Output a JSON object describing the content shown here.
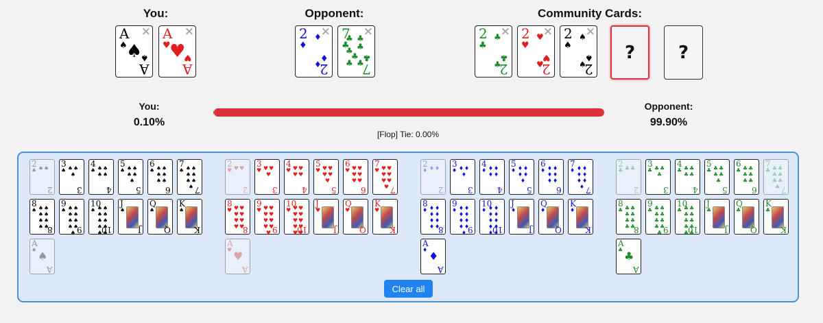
{
  "headings": {
    "you": "You:",
    "opponent": "Opponent:",
    "community": "Community Cards:"
  },
  "you_cards": [
    {
      "rank": "A",
      "suit": "♠",
      "color": "#000000"
    },
    {
      "rank": "A",
      "suit": "♥",
      "color": "#e02020"
    }
  ],
  "opponent_cards": [
    {
      "rank": "2",
      "suit": "♦",
      "color": "#1010dd"
    },
    {
      "rank": "7",
      "suit": "♣",
      "color": "#1a8a2a"
    }
  ],
  "community_cards": [
    {
      "rank": "2",
      "suit": "♣",
      "color": "#1a8a2a"
    },
    {
      "rank": "2",
      "suit": "♥",
      "color": "#e02020"
    },
    {
      "rank": "2",
      "suit": "♠",
      "color": "#000000"
    }
  ],
  "placeholders": [
    "?",
    "?"
  ],
  "close_glyph": "×",
  "equity": {
    "you_label": "You:",
    "you_pct": "0.10%",
    "opp_label": "Opponent:",
    "opp_pct": "99.90%",
    "you_fraction": 0.001,
    "opp_fraction": 0.999,
    "tie_text": "[Flop] Tie: 0.00%",
    "you_color": "#2a9d57",
    "opp_color": "#dc2f3a"
  },
  "picker": {
    "ranks": [
      "2",
      "3",
      "4",
      "5",
      "6",
      "7",
      "8",
      "9",
      "10",
      "J",
      "Q",
      "K",
      "A"
    ],
    "suits": [
      {
        "name": "spades",
        "symbol": "♠",
        "color": "#000000",
        "used": [
          "2",
          "A"
        ]
      },
      {
        "name": "hearts",
        "symbol": "♥",
        "color": "#e02020",
        "used": [
          "2",
          "A"
        ]
      },
      {
        "name": "diamonds",
        "symbol": "♦",
        "color": "#1010dd",
        "used": [
          "2"
        ]
      },
      {
        "name": "clubs",
        "symbol": "♣",
        "color": "#1a8a2a",
        "used": [
          "2",
          "7"
        ]
      }
    ]
  },
  "clear_all_label": "Clear all"
}
